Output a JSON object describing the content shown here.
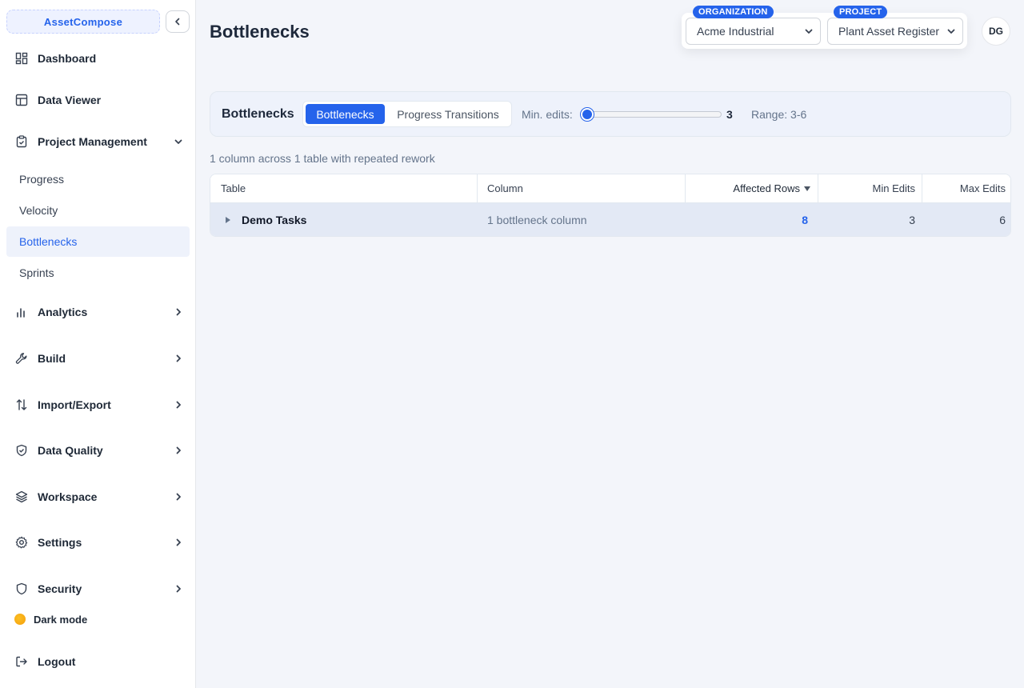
{
  "app": {
    "brand": "AssetCompose"
  },
  "sidebar": {
    "items": [
      {
        "label": "Dashboard"
      },
      {
        "label": "Data Viewer"
      },
      {
        "label": "Project Management"
      },
      {
        "label": "Analytics"
      },
      {
        "label": "Build"
      },
      {
        "label": "Import/Export"
      },
      {
        "label": "Data Quality"
      },
      {
        "label": "Workspace"
      },
      {
        "label": "Settings"
      },
      {
        "label": "Security"
      }
    ],
    "subitems": [
      {
        "label": "Progress"
      },
      {
        "label": "Velocity"
      },
      {
        "label": "Bottlenecks",
        "active": true
      },
      {
        "label": "Sprints"
      }
    ],
    "dark_mode_label": "Dark mode",
    "logout_label": "Logout"
  },
  "header": {
    "title": "Bottlenecks",
    "organization": {
      "pill": "ORGANIZATION",
      "value": "Acme Industrial"
    },
    "project": {
      "pill": "PROJECT",
      "value": "Plant Asset Register"
    },
    "avatar_initials": "DG"
  },
  "toolbar": {
    "title": "Bottlenecks",
    "tabs": [
      {
        "label": "Bottlenecks",
        "active": true
      },
      {
        "label": "Progress Transitions",
        "active": false
      }
    ],
    "min_edits_label": "Min. edits:",
    "min_edits_value": "3",
    "min_edits_fraction": 0,
    "range_label": "Range: 3-6"
  },
  "summary": "1 column across 1 table with repeated rework",
  "table": {
    "columns": [
      {
        "label": "Table"
      },
      {
        "label": "Column"
      },
      {
        "label": "Affected Rows",
        "sort": "desc"
      },
      {
        "label": "Min Edits"
      },
      {
        "label": "Max Edits"
      }
    ],
    "rows": [
      {
        "table": "Demo Tasks",
        "column": "1 bottleneck column",
        "affected": "8",
        "min": "3",
        "max": "6"
      }
    ]
  },
  "colors": {
    "accent": "#2563eb",
    "row_highlight": "#e3e9f5",
    "background": "#f3f5fa"
  }
}
